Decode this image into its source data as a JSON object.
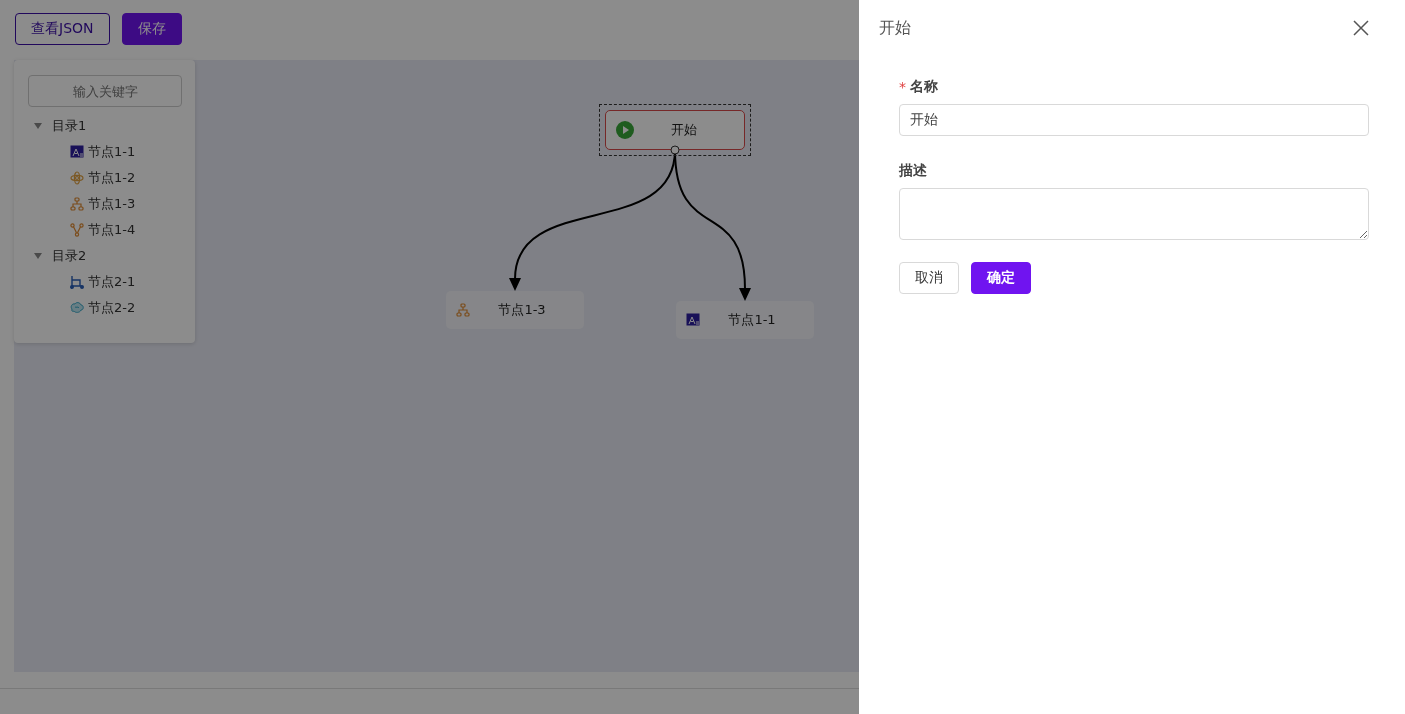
{
  "toolbar": {
    "buttons": [
      {
        "label": "查看JSON",
        "kind": "outline"
      },
      {
        "label": "保存",
        "kind": "primary"
      }
    ]
  },
  "palette": {
    "search": {
      "placeholder": "输入关键字"
    },
    "tree": [
      {
        "label": "目录1",
        "expanded": true,
        "children": [
          {
            "label": "节点1-1"
          },
          {
            "label": "节点1-2"
          },
          {
            "label": "节点1-3"
          },
          {
            "label": "节点1-4"
          }
        ]
      },
      {
        "label": "目录2",
        "expanded": true,
        "children": [
          {
            "label": "节点2-1"
          },
          {
            "label": "节点2-2"
          }
        ]
      }
    ]
  },
  "canvas": {
    "nodes": [
      {
        "label": "开始",
        "kind": "start",
        "selected": true
      },
      {
        "label": "节点1-3",
        "kind": "task",
        "selected": false
      },
      {
        "label": "节点1-1",
        "kind": "task",
        "selected": false
      }
    ]
  },
  "drawer": {
    "title": "开始",
    "fields": [
      {
        "label": "名称",
        "required_mark": "*",
        "kind": "input",
        "value": "开始"
      },
      {
        "label": "描述",
        "kind": "textarea"
      }
    ],
    "buttons": [
      {
        "label": "取消",
        "kind": "default"
      },
      {
        "label": "确定",
        "kind": "primary"
      }
    ]
  }
}
